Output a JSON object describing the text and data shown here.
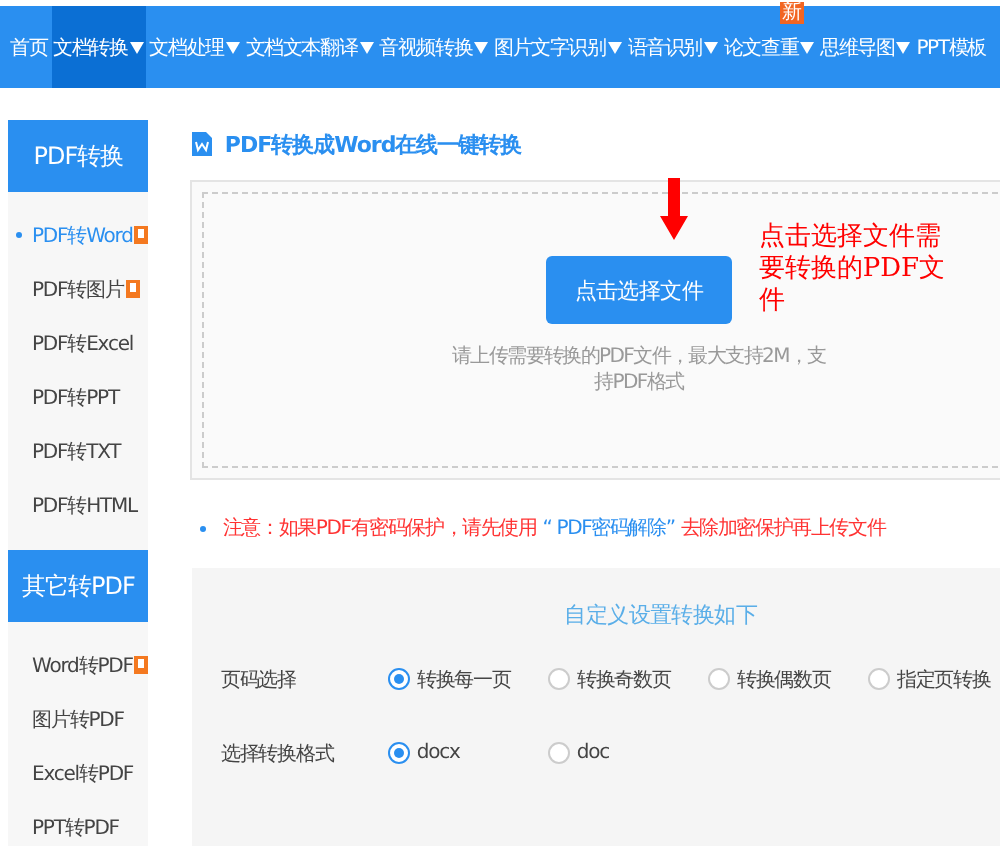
{
  "nav": [
    {
      "label": "首页",
      "selected": false,
      "dropdown": false
    },
    {
      "label": "文档转换",
      "selected": true,
      "dropdown": true
    },
    {
      "label": "文档处理",
      "selected": false,
      "dropdown": true
    },
    {
      "label": "文档文本翻译",
      "selected": false,
      "dropdown": true
    },
    {
      "label": "音视频转换",
      "selected": false,
      "dropdown": true
    },
    {
      "label": "图片文字识别",
      "selected": false,
      "dropdown": true
    },
    {
      "label": "语音识别",
      "selected": false,
      "dropdown": true
    },
    {
      "label": "论文查重",
      "selected": false,
      "dropdown": true,
      "badge": "新"
    },
    {
      "label": "思维导图",
      "selected": false,
      "dropdown": true
    },
    {
      "label": "PPT模板",
      "selected": false,
      "dropdown": false
    }
  ],
  "sidebar": [
    {
      "title": "PDF转换",
      "items": [
        {
          "label": "PDF转Word",
          "selected": true,
          "hot": true
        },
        {
          "label": "PDF转图片",
          "selected": false,
          "hot": true
        },
        {
          "label": "PDF转Excel",
          "selected": false,
          "hot": false
        },
        {
          "label": "PDF转PPT",
          "selected": false,
          "hot": false
        },
        {
          "label": "PDF转TXT",
          "selected": false,
          "hot": false
        },
        {
          "label": "PDF转HTML",
          "selected": false,
          "hot": false
        }
      ]
    },
    {
      "title": "其它转PDF",
      "items": [
        {
          "label": "Word转PDF",
          "selected": false,
          "hot": true
        },
        {
          "label": "图片转PDF",
          "selected": false,
          "hot": false
        },
        {
          "label": "Excel转PDF",
          "selected": false,
          "hot": false
        },
        {
          "label": "PPT转PDF",
          "selected": false,
          "hot": false
        }
      ]
    }
  ],
  "main": {
    "title": "PDF转换成Word在线一键转换",
    "upload": {
      "button": "点击选择文件",
      "annotation": "点击选择文件需要转换的PDF文件",
      "hint": "请上传需要转换的PDF文件，最大支持2M，支持PDF格式"
    },
    "notice": [
      {
        "kind": "warning",
        "text": "注意：如果PDF有密码保护，请先使用"
      },
      {
        "kind": "link",
        "text": "“ PDF密码解除”"
      },
      {
        "kind": "warning",
        "text": "去除加密保护再上传文件"
      }
    ],
    "settings": {
      "title": "自定义设置转换如下",
      "rows": [
        {
          "label": "页码选择",
          "options": [
            {
              "label": "转换每一页",
              "selected": true
            },
            {
              "label": "转换奇数页",
              "selected": false
            },
            {
              "label": "转换偶数页",
              "selected": false
            },
            {
              "label": "指定页转换",
              "selected": false
            }
          ]
        },
        {
          "label": "选择转换格式",
          "options": [
            {
              "label": "docx",
              "selected": true
            },
            {
              "label": "doc",
              "selected": false
            }
          ]
        }
      ]
    }
  }
}
